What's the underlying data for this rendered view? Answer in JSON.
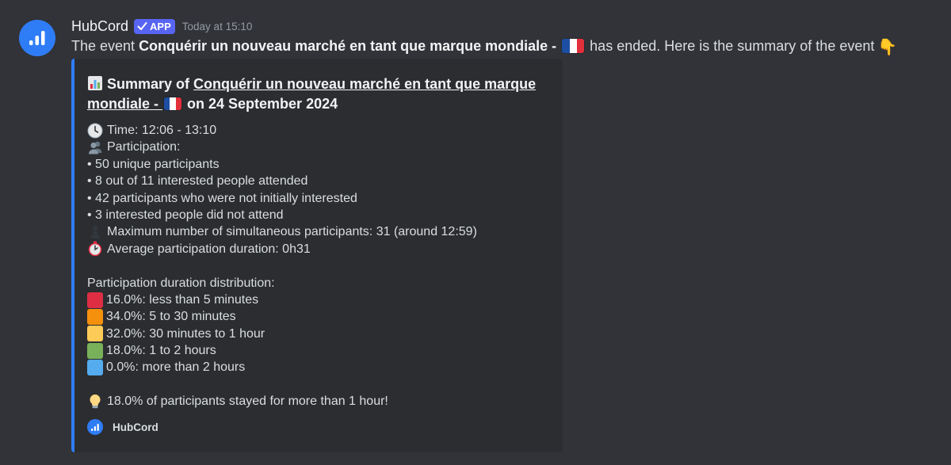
{
  "author": {
    "username": "HubCord",
    "badge": "APP",
    "timestamp": "Today at 15:10",
    "avatar_icon": "bar-chart-icon",
    "avatar_color": "#2f7df6"
  },
  "message": {
    "prefix": "The event ",
    "event_name": "Conquérir un nouveau marché en tant que marque mondiale -",
    "suffix": " has ended. Here is the summary of the event",
    "flag_icon": "france-flag-icon",
    "emoji_icon": "pointing-down-hand-icon"
  },
  "embed": {
    "accent_color": "#2f7df6",
    "title_prefix": "Summary of ",
    "title_link_line1": "Conquérir un nouveau marché en tant que marque",
    "title_link_line2": "mondiale - ",
    "title_suffix": " on 24 September 2024",
    "time": "Time: 12:06 - 13:10",
    "participation_label": "Participation:",
    "stats": [
      "• 50 unique participants",
      "• 8 out of 11 interested people attended",
      "• 42 participants who were not initially interested",
      "• 3 interested people did not attend"
    ],
    "max_simultaneous": "Maximum number of simultaneous participants: 31 (around 12:59)",
    "avg_duration": "Average participation duration: 0h31",
    "distribution_label": "Participation duration distribution:",
    "distribution": [
      {
        "label": "16.0%: less than 5 minutes",
        "color": "#dd2e44"
      },
      {
        "label": "34.0%: 5 to 30 minutes",
        "color": "#f4900c"
      },
      {
        "label": "32.0%: 30 minutes to 1 hour",
        "color": "#fdcb58"
      },
      {
        "label": "18.0%: 1 to 2 hours",
        "color": "#78b159"
      },
      {
        "label": "0.0%: more than 2 hours",
        "color": "#55acee"
      }
    ],
    "highlight": "18.0% of participants stayed for more than 1 hour!",
    "footer_text": "HubCord"
  }
}
